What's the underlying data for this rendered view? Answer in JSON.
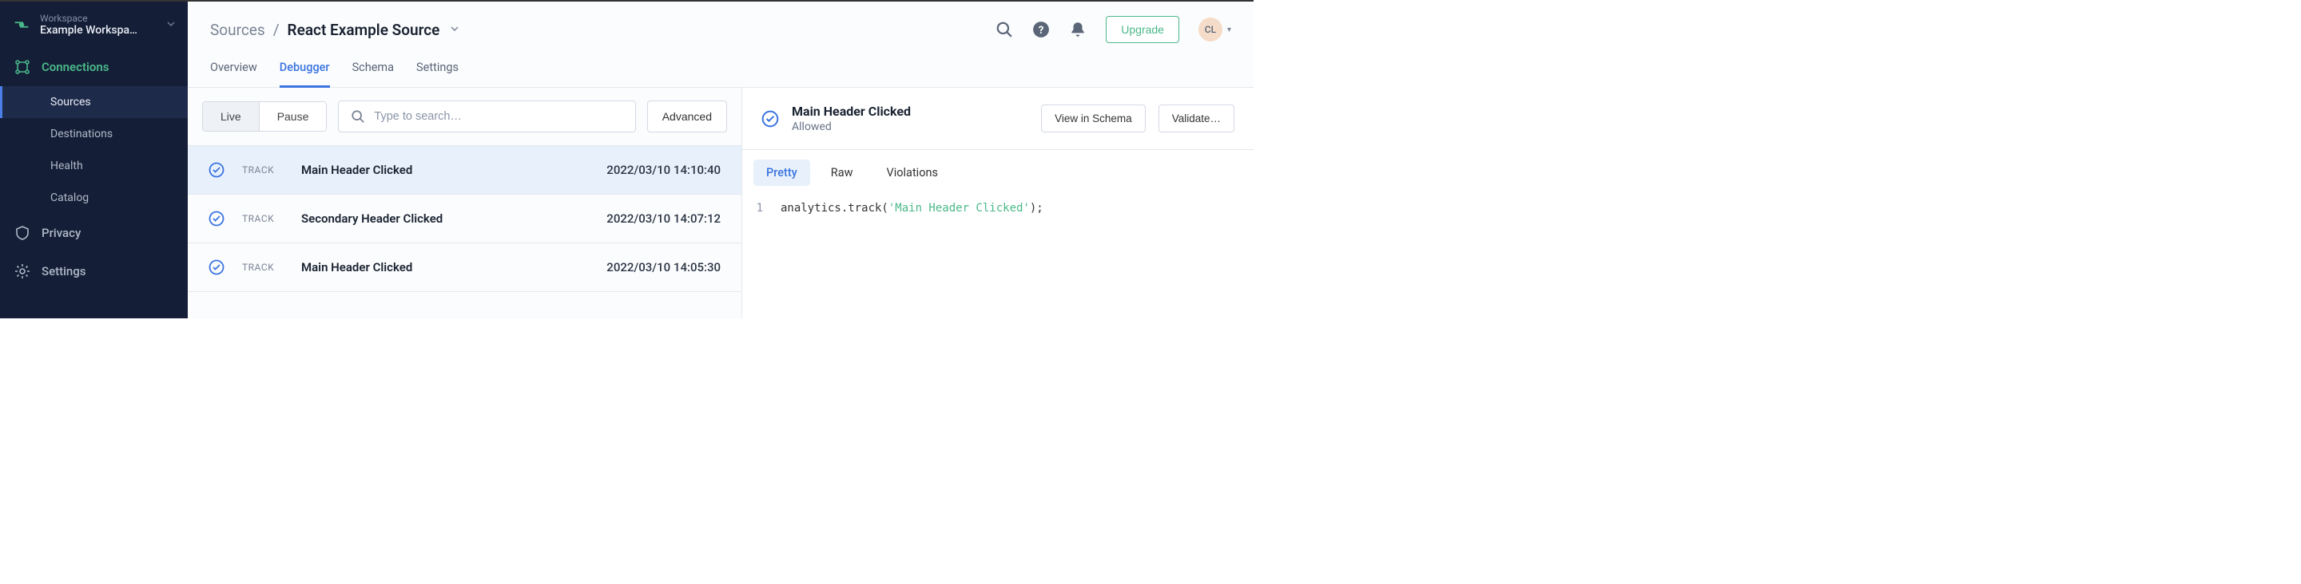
{
  "workspace": {
    "label": "Workspace",
    "name": "Example Workspa…"
  },
  "sidebar": {
    "connections": {
      "label": "Connections",
      "items": [
        "Sources",
        "Destinations",
        "Health",
        "Catalog"
      ]
    },
    "privacy": {
      "label": "Privacy"
    },
    "settings": {
      "label": "Settings"
    }
  },
  "header": {
    "crumb_parent": "Sources",
    "crumb_sep": "/",
    "crumb_current": "React Example Source",
    "upgrade": "Upgrade",
    "avatar_initials": "CL"
  },
  "tabs": [
    "Overview",
    "Debugger",
    "Schema",
    "Settings"
  ],
  "toolbar": {
    "live": "Live",
    "pause": "Pause",
    "search_placeholder": "Type to search…",
    "advanced": "Advanced"
  },
  "events": [
    {
      "type": "TRACK",
      "name": "Main Header Clicked",
      "time": "2022/03/10 14:10:40",
      "selected": true
    },
    {
      "type": "TRACK",
      "name": "Secondary Header Clicked",
      "time": "2022/03/10 14:07:12",
      "selected": false
    },
    {
      "type": "TRACK",
      "name": "Main Header Clicked",
      "time": "2022/03/10 14:05:30",
      "selected": false
    }
  ],
  "detail": {
    "title": "Main Header Clicked",
    "status": "Allowed",
    "view_in_schema": "View in Schema",
    "validate": "Validate…",
    "tabs": [
      "Pretty",
      "Raw",
      "Violations"
    ],
    "code": {
      "line_no": "1",
      "prefix": "analytics.track(",
      "string": "'Main Header Clicked'",
      "suffix": ");"
    }
  }
}
